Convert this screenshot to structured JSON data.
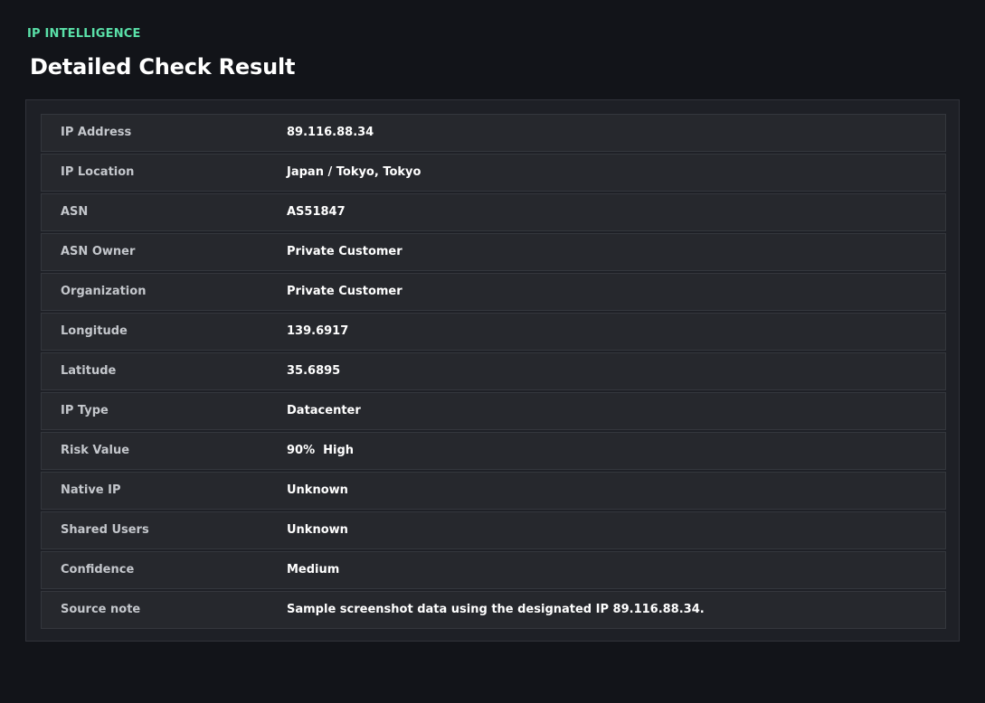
{
  "header": {
    "eyebrow": "IP INTELLIGENCE",
    "title": "Detailed Check Result"
  },
  "colors": {
    "background": "#121419",
    "panel": "#1e2026",
    "row": "#26282d",
    "accent": "#5ae0a8"
  },
  "rows": [
    {
      "label": "IP Address",
      "value": "89.116.88.34"
    },
    {
      "label": "IP Location",
      "value": "Japan / Tokyo, Tokyo"
    },
    {
      "label": "ASN",
      "value": "AS51847"
    },
    {
      "label": "ASN Owner",
      "value": "Private Customer"
    },
    {
      "label": "Organization",
      "value": "Private Customer"
    },
    {
      "label": "Longitude",
      "value": "139.6917"
    },
    {
      "label": "Latitude",
      "value": "35.6895"
    },
    {
      "label": "IP Type",
      "value": "Datacenter"
    },
    {
      "label": "Risk Value",
      "value": "90%  High"
    },
    {
      "label": "Native IP",
      "value": "Unknown"
    },
    {
      "label": "Shared Users",
      "value": "Unknown"
    },
    {
      "label": "Confidence",
      "value": "Medium"
    },
    {
      "label": "Source note",
      "value": "Sample screenshot data using the designated IP 89.116.88.34."
    }
  ]
}
